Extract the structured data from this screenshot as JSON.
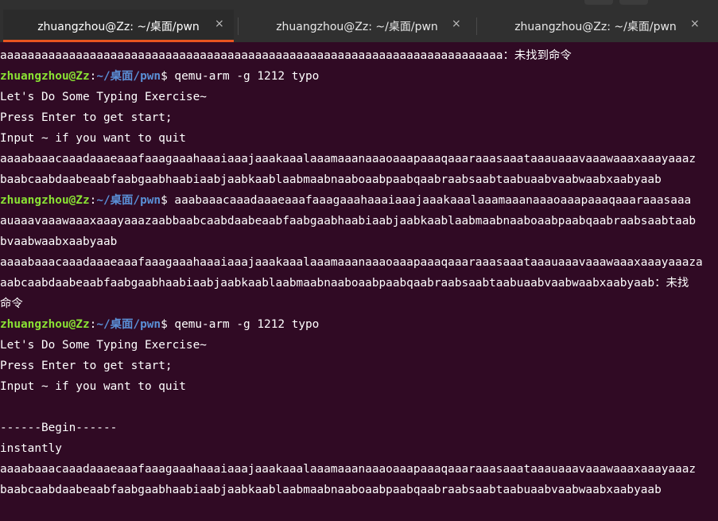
{
  "tabs": [
    {
      "title": "zhuangzhou@Zz: ~/桌面/pwn",
      "active": true
    },
    {
      "title": "zhuangzhou@Zz: ~/桌面/pwn",
      "active": false
    },
    {
      "title": "zhuangzhou@Zz: ~/桌面/pwn",
      "active": false
    }
  ],
  "colors": {
    "background": "#300a24",
    "prompt_user": "#8ae234",
    "prompt_path": "#5a8fd6",
    "active_tab_accent": "#e95420"
  },
  "terminal": {
    "prompt": {
      "user_host": "zhuangzhou@Zz",
      "colon": ":",
      "path": "~/桌面/pwn",
      "symbol": "$ "
    },
    "lines": [
      {
        "kind": "text",
        "text": "aaaaaaaaaaaaaaaaaaaaaaaaaaaaaaaaaaaaaaaaaaaaaaaaaaaaaaaaaaaaaaaaaaaaaaaaa：未找到命令"
      },
      {
        "kind": "prompt",
        "cmd": "qemu-arm -g 1212 typo"
      },
      {
        "kind": "text",
        "text": "Let's Do Some Typing Exercise~"
      },
      {
        "kind": "text",
        "text": "Press Enter to get start;"
      },
      {
        "kind": "text",
        "text": "Input ~ if you want to quit"
      },
      {
        "kind": "text",
        "text": "aaaabaaacaaadaaaeaaafaaagaaahaaaiaaajaaakaaalaaamaaanaaaoaaapaaaqaaaraaasaaataaauaaavaaawaaaxaaayaaaz"
      },
      {
        "kind": "text",
        "text": "baabcaabdaabeaabfaabgaabhaabiaabjaabkaablaabmaabnaaboaabpaabqaabraabsaabtaabuaabvaabwaabxaabyaab"
      },
      {
        "kind": "prompt",
        "cmd": "aaabaaacaaadaaaeaaafaaagaaahaaaiaaajaaakaaalaaamaaanaaaoaaapaaaqaaaraaasaaa"
      },
      {
        "kind": "text",
        "text": "auaaavaaawaaaxaaayaaazaabbaabcaabdaabeaabfaabgaabhaabiaabjaabkaablaabmaabnaaboaabpaabqaabraabsaabtaab"
      },
      {
        "kind": "text",
        "text": "bvaabwaabxaabyaab"
      },
      {
        "kind": "text",
        "text": "aaaabaaacaaadaaaeaaafaaagaaahaaaiaaajaaakaaalaaamaaanaaaoaaapaaaqaaaraaasaaataaauaaavaaawaaaxaaayaaaza"
      },
      {
        "kind": "text",
        "text": "aabcaabdaabeaabfaabgaabhaabiaabjaabkaablaabmaabnaaboaabpaabqaabraabsaabtaabuaabvaabwaabxaabyaab：未找"
      },
      {
        "kind": "text",
        "text": "命令"
      },
      {
        "kind": "prompt",
        "cmd": "qemu-arm -g 1212 typo"
      },
      {
        "kind": "text",
        "text": "Let's Do Some Typing Exercise~"
      },
      {
        "kind": "text",
        "text": "Press Enter to get start;"
      },
      {
        "kind": "text",
        "text": "Input ~ if you want to quit"
      },
      {
        "kind": "text",
        "text": ""
      },
      {
        "kind": "text",
        "text": "------Begin------"
      },
      {
        "kind": "text",
        "text": "instantly"
      },
      {
        "kind": "text",
        "text": "aaaabaaacaaadaaaeaaafaaagaaahaaaiaaajaaakaaalaaamaaanaaaoaaapaaaqaaaraaasaaataaauaaavaaawaaaxaaayaaaz"
      },
      {
        "kind": "text",
        "text": "baabcaabdaabeaabfaabgaabhaabiaabjaabkaablaabmaabnaaboaabpaabqaabraabsaabtaabuaabvaabwaabxaabyaab"
      }
    ]
  }
}
